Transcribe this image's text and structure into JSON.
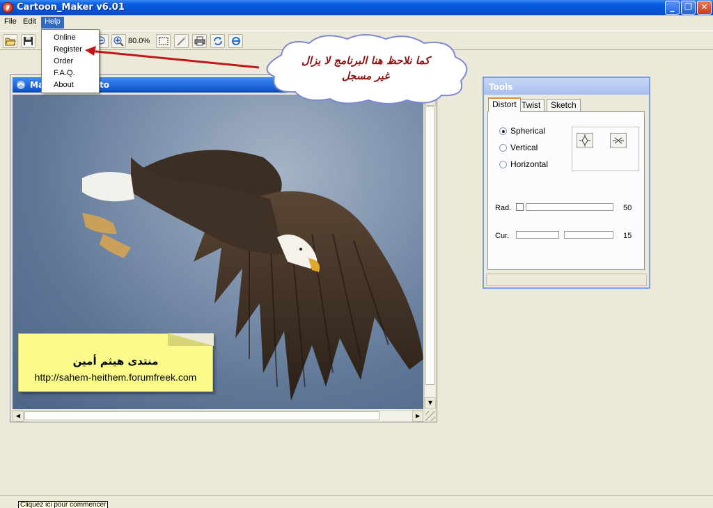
{
  "window": {
    "title": "Cartoon_Maker v6.01"
  },
  "menu": {
    "file": "File",
    "edit": "Edit",
    "help": "Help"
  },
  "help_menu": [
    "Online",
    "Register",
    "Order",
    "F.A.Q.",
    "About"
  ],
  "toolbar": {
    "zoom": "80.0%"
  },
  "image_window": {
    "title": "Ma",
    "title_tail": "to"
  },
  "annotation": {
    "line1": "كما نلاحظ هنا البرنامج لا يزال",
    "line2": "غير مسجل"
  },
  "note": {
    "arabic": "منتدى هيثم أمين",
    "url": "http://sahem-heithem.forumfreek.com"
  },
  "tools": {
    "title": "Tools",
    "tabs": [
      "Distort",
      "Twist",
      "Sketch"
    ],
    "modes": [
      "Spherical",
      "Vertical",
      "Horizontal"
    ],
    "selected_mode": "Spherical",
    "rad_label": "Rad.",
    "rad_value": "50",
    "cur_label": "Cur.",
    "cur_value": "15"
  },
  "status": {
    "tip": "Cliquez ici pour commencer"
  }
}
